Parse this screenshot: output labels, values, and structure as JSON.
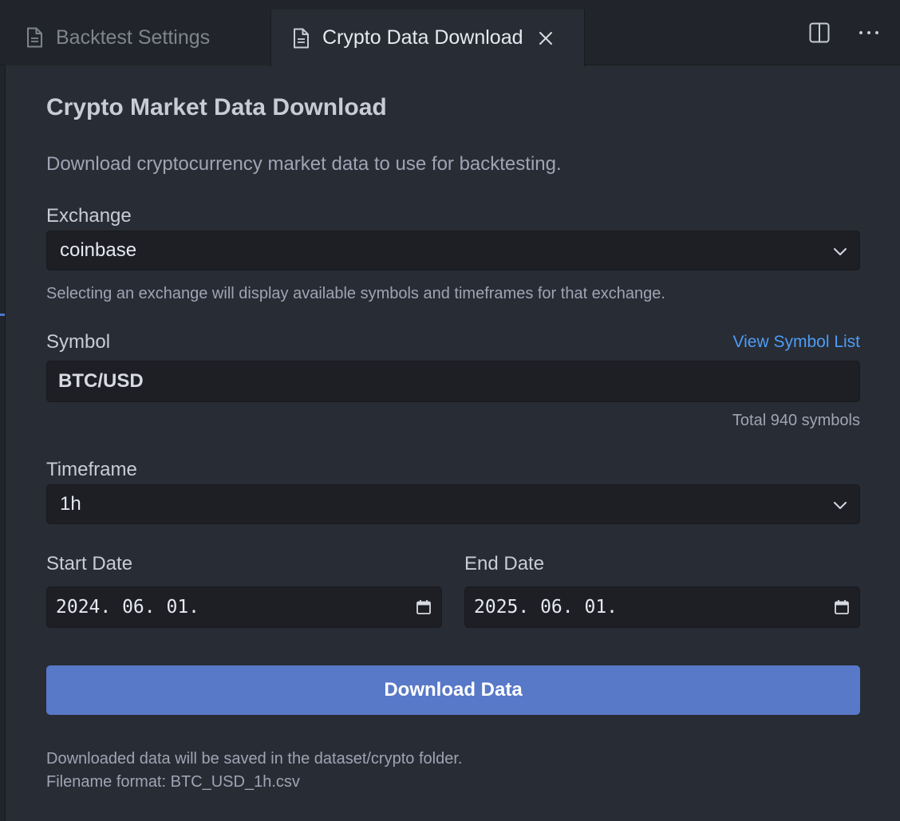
{
  "tabs": [
    {
      "label": "Backtest Settings",
      "active": false
    },
    {
      "label": "Crypto Data Download",
      "active": true
    }
  ],
  "icons": {
    "file": "file-icon",
    "close": "close-icon",
    "split": "split-editor-icon",
    "more": "more-actions-icon",
    "chevron": "chevron-down-icon",
    "calendar": "calendar-icon"
  },
  "form": {
    "title": "Crypto Market Data Download",
    "description": "Download cryptocurrency market data to use for backtesting.",
    "exchange": {
      "label": "Exchange",
      "value": "coinbase",
      "hint": "Selecting an exchange will display available symbols and timeframes for that exchange."
    },
    "symbol": {
      "label": "Symbol",
      "link": "View Symbol List",
      "value": "BTC/USD",
      "count": "Total 940 symbols"
    },
    "timeframe": {
      "label": "Timeframe",
      "value": "1h"
    },
    "start_date": {
      "label": "Start Date",
      "value": "2024. 06. 01."
    },
    "end_date": {
      "label": "End Date",
      "value": "2025. 06. 01."
    },
    "download_label": "Download Data",
    "footer_line1": "Downloaded data will be saved in the dataset/crypto folder.",
    "footer_line2": "Filename format: BTC_USD_1h.csv"
  },
  "colors": {
    "background": "#282c34",
    "tabbar": "#21252b",
    "input_bg": "#1d1f24",
    "accent_button": "#5878c8",
    "link": "#4d9cf6"
  }
}
